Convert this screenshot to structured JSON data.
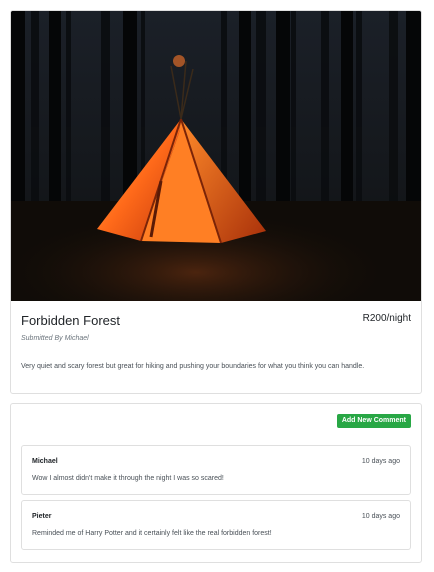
{
  "campground": {
    "photo_alt": "Orange tipi tent glowing at night in a forest",
    "name": "Forbidden Forest",
    "price": "R200/night",
    "submitted_by": "Submitted By Michael",
    "description": "Very quiet and scary forest but great for hiking and pushing your boundaries for what you think you can handle."
  },
  "comments": {
    "add_label": "Add New Comment",
    "items": [
      {
        "author": "Michael",
        "time": "10 days ago",
        "text": "Wow I almost didn't make it through the night I was so scared!"
      },
      {
        "author": "Pieter",
        "time": "10 days ago",
        "text": "Reminded me of Harry Potter and it certainly felt like the real forbidden forest!"
      }
    ]
  },
  "colors": {
    "add_button": "#28a745",
    "tent_glow": "#ff6a1a"
  }
}
